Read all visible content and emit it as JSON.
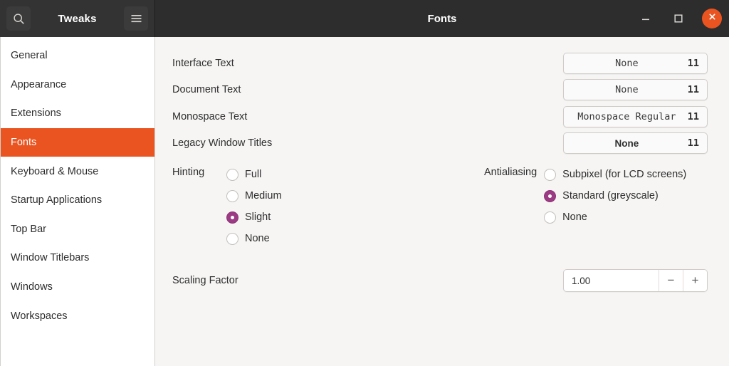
{
  "sidebar_header": {
    "title": "Tweaks",
    "search_icon": "search-icon",
    "menu_icon": "hamburger-menu-icon"
  },
  "window": {
    "title": "Fonts",
    "minimize_icon": "minimize-icon",
    "maximize_icon": "maximize-icon",
    "close_icon": "close-icon",
    "accent_color": "#e95420",
    "titlebar_color": "#2d2d2d"
  },
  "sidebar": {
    "selected": "Fonts",
    "items": [
      {
        "label": "General"
      },
      {
        "label": "Appearance"
      },
      {
        "label": "Extensions"
      },
      {
        "label": "Fonts"
      },
      {
        "label": "Keyboard & Mouse"
      },
      {
        "label": "Startup Applications"
      },
      {
        "label": "Top Bar"
      },
      {
        "label": "Window Titlebars"
      },
      {
        "label": "Windows"
      },
      {
        "label": "Workspaces"
      }
    ]
  },
  "fonts": {
    "rows": [
      {
        "label": "Interface Text",
        "font_name": "None",
        "font_size": "11"
      },
      {
        "label": "Document Text",
        "font_name": "None",
        "font_size": "11"
      },
      {
        "label": "Monospace Text",
        "font_name": "Monospace Regular",
        "font_size": "11"
      },
      {
        "label": "Legacy Window Titles",
        "font_name": "None",
        "font_size": "11"
      }
    ]
  },
  "hinting": {
    "label": "Hinting",
    "selected": "Slight",
    "options": [
      {
        "label": "Full",
        "checked": false
      },
      {
        "label": "Medium",
        "checked": false
      },
      {
        "label": "Slight",
        "checked": true
      },
      {
        "label": "None",
        "checked": false
      }
    ]
  },
  "antialiasing": {
    "label": "Antialiasing",
    "selected": "Standard (greyscale)",
    "options": [
      {
        "label": "Subpixel (for LCD screens)",
        "checked": false
      },
      {
        "label": "Standard (greyscale)",
        "checked": true
      },
      {
        "label": "None",
        "checked": false
      }
    ]
  },
  "scaling": {
    "label": "Scaling Factor",
    "value": "1.00",
    "decrement_label": "−",
    "increment_label": "+"
  },
  "colors": {
    "selection": "#e95420",
    "radio_checked": "#9c3b84",
    "panel_bg": "#f6f5f4",
    "sidebar_bg": "#ffffff"
  }
}
